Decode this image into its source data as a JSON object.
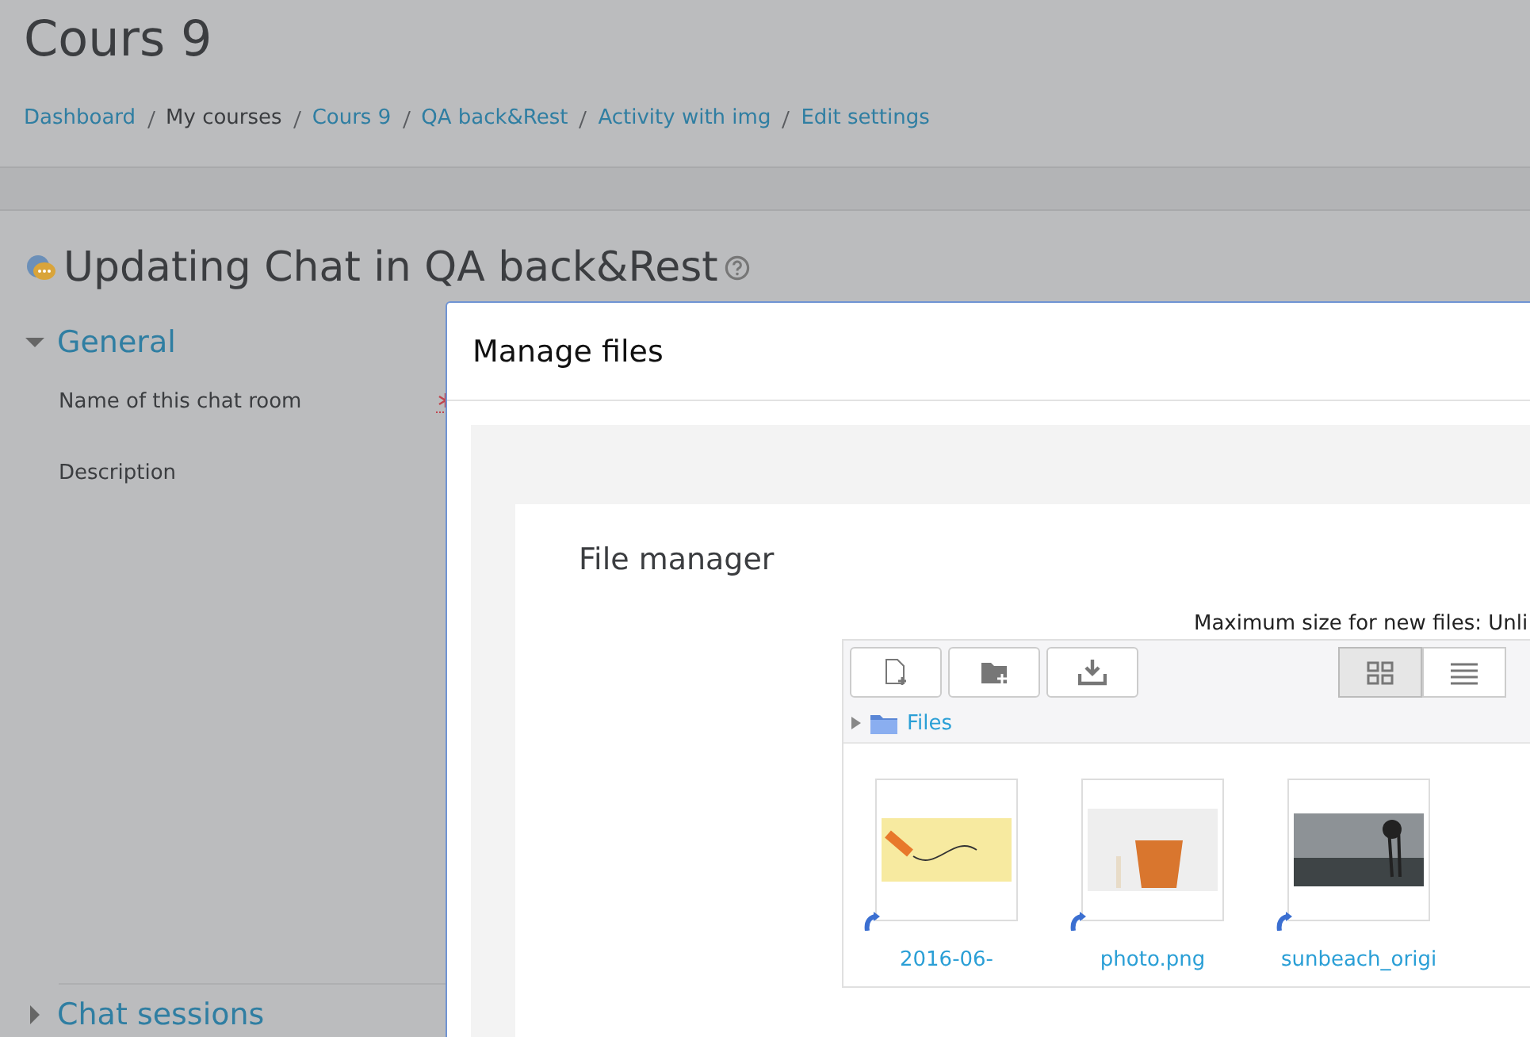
{
  "page": {
    "title": "Cours 9",
    "breadcrumb": [
      {
        "label": "Dashboard",
        "link": true
      },
      {
        "label": "My courses",
        "link": false
      },
      {
        "label": "Cours 9",
        "link": true
      },
      {
        "label": "QA back&Rest",
        "link": true
      },
      {
        "label": "Activity with img",
        "link": true
      },
      {
        "label": "Edit settings",
        "link": true
      }
    ],
    "heading": "Updating Chat in QA back&Rest"
  },
  "sections": [
    {
      "title": "General",
      "expanded": true,
      "fields": [
        {
          "label": "Name of this chat room",
          "required": true
        },
        {
          "label": "Description",
          "required": false
        }
      ]
    },
    {
      "title": "Chat sessions",
      "expanded": false
    }
  ],
  "dialog": {
    "title": "Manage files",
    "panel_title": "File manager",
    "max_size": "Maximum size for new files: Unli",
    "toolbar": [
      {
        "kind": "add-file"
      },
      {
        "kind": "new-folder"
      },
      {
        "kind": "download"
      }
    ],
    "views": [
      {
        "kind": "icons",
        "selected": true
      },
      {
        "kind": "list",
        "selected": false
      }
    ],
    "path": "Files",
    "files": [
      {
        "name": "2016-06-",
        "kind": "note"
      },
      {
        "name": "photo.png",
        "kind": "box"
      },
      {
        "name": "sunbeach_origi",
        "kind": "beach"
      }
    ]
  }
}
